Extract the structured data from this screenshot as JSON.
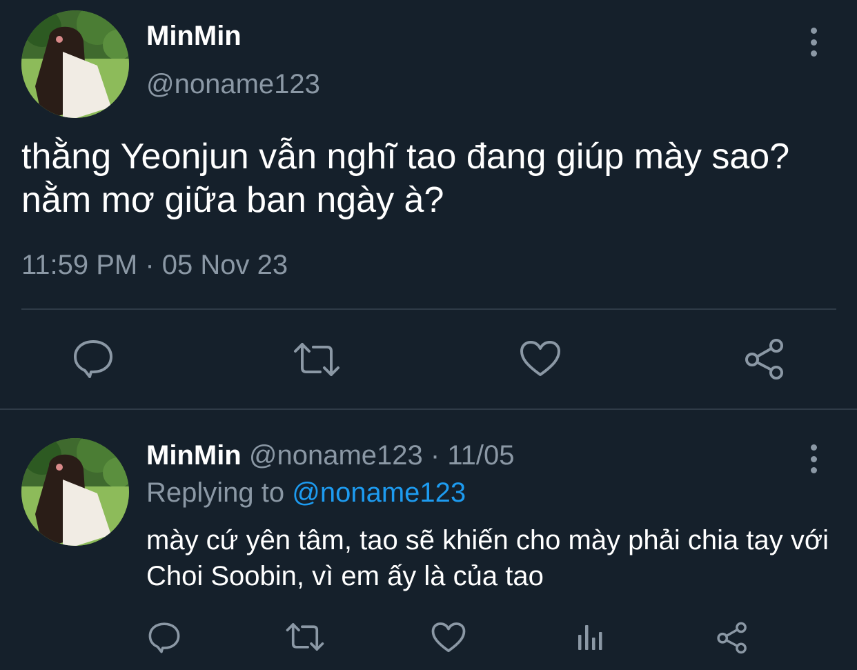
{
  "main_tweet": {
    "display_name": "MinMin",
    "handle": "@noname123",
    "text": "thằng Yeonjun vẫn nghĩ tao đang giúp mày sao? nằm mơ giữa ban ngày à?",
    "timestamp": "11:59 PM · 05 Nov 23",
    "actions": [
      "reply-icon",
      "retweet-icon",
      "like-icon",
      "share-icon"
    ]
  },
  "reply_tweet": {
    "display_name": "MinMin",
    "handle": "@noname123",
    "separator": "·",
    "date": "11/05",
    "replying_prefix": "Replying to",
    "replying_to": "@noname123",
    "text": "mày cứ yên tâm, tao sẽ khiến cho mày phải chia tay với Choi Soobin, vì em ấy là của tao",
    "actions": [
      "reply-icon",
      "retweet-icon",
      "like-icon",
      "views-icon",
      "share-icon"
    ]
  },
  "colors": {
    "background": "#15202b",
    "text": "#ffffff",
    "muted": "#8b98a5",
    "accent": "#1d9bf0",
    "divider": "#2f3b47"
  }
}
